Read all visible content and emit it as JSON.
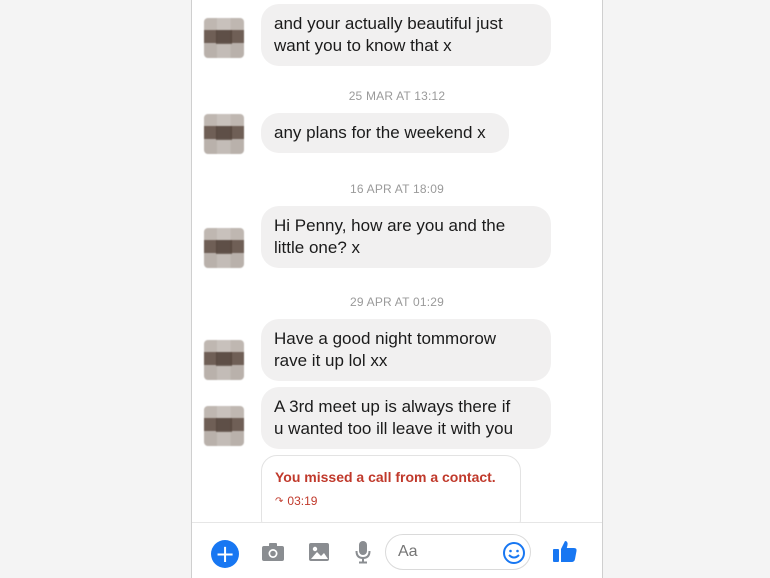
{
  "messages": [
    {
      "text": "and your actually beautiful just\nwant you to know that x"
    },
    {
      "text": "any plans for the weekend x"
    },
    {
      "text": "Hi Penny, how are you and the\nlittle one? x"
    },
    {
      "text": "Have a good night tommorow\nrave it up lol xx"
    },
    {
      "text": "A 3rd meet up is always there if\nu wanted too ill leave it with you"
    }
  ],
  "timestamps": [
    "25 MAR AT 13:12",
    "16 APR AT 18:09",
    "29 APR AT 01:29"
  ],
  "missed_call": {
    "title": "You missed a call from a contact.",
    "time": "03:19"
  },
  "composer": {
    "placeholder": "Aa"
  },
  "colors": {
    "accent": "#1877f2",
    "bubble": "#f1f0f0",
    "missed_call": "#c0392b"
  },
  "icons": [
    "plus-icon",
    "camera-icon",
    "image-icon",
    "microphone-icon",
    "emoji-icon",
    "thumbs-up-icon"
  ]
}
